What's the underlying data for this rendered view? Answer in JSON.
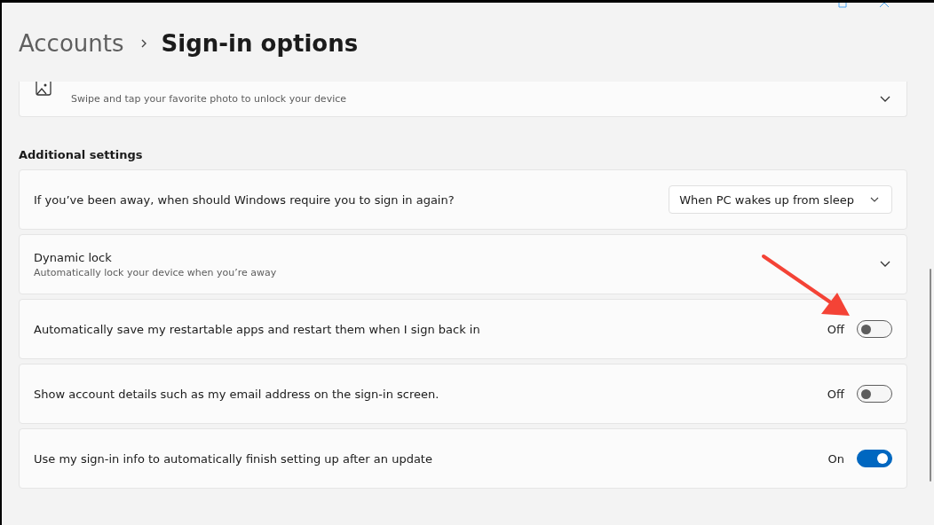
{
  "breadcrumb": {
    "parent": "Accounts",
    "current": "Sign-in options"
  },
  "top_card": {
    "description": "Swipe and tap your favorite photo to unlock your device",
    "expanded": false
  },
  "section_title": "Additional settings",
  "rows": [
    {
      "kind": "dropdown",
      "title": "If you’ve been away, when should Windows require you to sign in again?",
      "value": "When PC wakes up from sleep"
    },
    {
      "kind": "expander",
      "title": "Dynamic lock",
      "description": "Automatically lock your device when you’re away",
      "expanded": false
    },
    {
      "kind": "toggle",
      "title": "Automatically save my restartable apps and restart them when I sign back in",
      "state_label": "Off",
      "on": false
    },
    {
      "kind": "toggle",
      "title": "Show account details such as my email address on the sign-in screen.",
      "state_label": "Off",
      "on": false
    },
    {
      "kind": "toggle",
      "title": "Use my sign-in info to automatically finish setting up after an update",
      "state_label": "On",
      "on": true
    }
  ]
}
